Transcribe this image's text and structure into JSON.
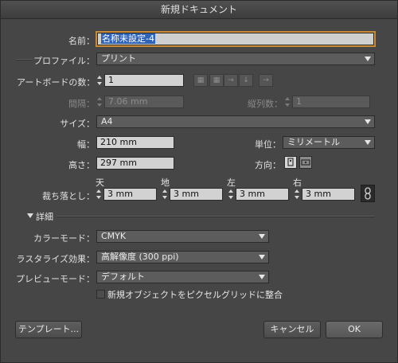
{
  "window": {
    "title": "新規ドキュメント"
  },
  "name": {
    "label": "名前：",
    "value": "名称未設定-4"
  },
  "profile": {
    "label": "プロファイル：",
    "value": "プリント"
  },
  "artboards": {
    "label": "アートボードの数：",
    "value": "1"
  },
  "spacing": {
    "label": "間隔：",
    "value": "7.06 mm"
  },
  "columns": {
    "label": "縦列数：",
    "value": "1"
  },
  "size": {
    "label": "サイズ：",
    "value": "A4"
  },
  "width": {
    "label": "幅：",
    "value": "210 mm"
  },
  "height": {
    "label": "高さ：",
    "value": "297 mm"
  },
  "units": {
    "label": "単位：",
    "value": "ミリメートル"
  },
  "orientation": {
    "label": "方向："
  },
  "bleed": {
    "label": "裁ち落とし：",
    "top_label": "天",
    "top": "3 mm",
    "bottom_label": "地",
    "bottom": "3 mm",
    "left_label": "左",
    "left": "3 mm",
    "right_label": "右",
    "right": "3 mm"
  },
  "advanced": {
    "label": "詳細"
  },
  "color_mode": {
    "label": "カラーモード：",
    "value": "CMYK"
  },
  "raster": {
    "label": "ラスタライズ効果：",
    "value": "高解像度 (300 ppi)"
  },
  "preview": {
    "label": "プレビューモード：",
    "value": "デフォルト"
  },
  "pixel_grid": {
    "label": "新規オブジェクトをピクセルグリッドに整合"
  },
  "buttons": {
    "templates": "テンプレート...",
    "cancel": "キャンセル",
    "ok": "OK"
  },
  "colors": {
    "focus": "#c98a34",
    "selection": "#2f63b8",
    "dialog_bg": "#464646"
  }
}
